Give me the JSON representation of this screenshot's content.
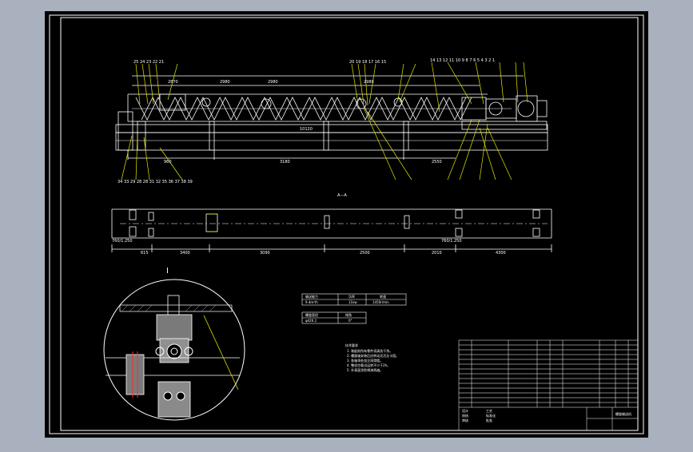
{
  "colors": {
    "background": "#a9b1be",
    "paper": "#000000",
    "line": "#ffffff",
    "leader": "#e6e600",
    "accent_red": "#ff2a2a",
    "hatch": "#b5b5b5"
  },
  "top_view": {
    "dim_top": [
      "2870",
      "2980",
      "2980",
      "2980"
    ],
    "dim_bottom": [
      "960",
      "3180",
      "2550"
    ],
    "overall_length": "10120",
    "part_numbers_left": [
      "25",
      "24",
      "23",
      "22",
      "21"
    ],
    "part_numbers_mid": [
      "20",
      "19",
      "18",
      "17",
      "16",
      "15"
    ],
    "part_numbers_right": [
      "14",
      "13",
      "12",
      "11",
      "10",
      "9",
      "8",
      "7",
      "6",
      "5",
      "4",
      "3",
      "2",
      "1"
    ],
    "part_numbers_bottom": [
      "34",
      "33",
      "29",
      "28",
      "28",
      "31",
      "32",
      "35",
      "36",
      "37",
      "38",
      "39"
    ],
    "view_label": "A—A"
  },
  "plan_view": {
    "dims": [
      "615",
      "3400",
      "3090",
      "2500",
      "2010",
      "4300"
    ],
    "left_note": "760/1.250",
    "right_note": "760/1.250",
    "section_label": "I"
  },
  "spec_table": {
    "header": [
      "输送能力",
      "功率",
      "转速"
    ],
    "row": [
      "9.4m³/h",
      "11kw",
      "1450r/min"
    ]
  },
  "spec_table_2": {
    "header": [
      "螺旋直径",
      "倾角"
    ],
    "row": [
      "φ426.2",
      "0°"
    ]
  },
  "notes": {
    "heading": "技术要求",
    "lines": [
      "1. 装配前所有零件须清洗干净。",
      "2. 螺旋轴安装后应转动灵活无卡阻。",
      "3. 各轴承处加注润滑脂。",
      "4. 整机空载试运转不少于2h。",
      "5. 外表面涂防锈漆两遍。"
    ]
  },
  "title_block": {
    "drawing_name": "螺旋输送机",
    "labels": [
      "设计",
      "校核",
      "审核",
      "工艺",
      "标准化",
      "批准"
    ]
  }
}
